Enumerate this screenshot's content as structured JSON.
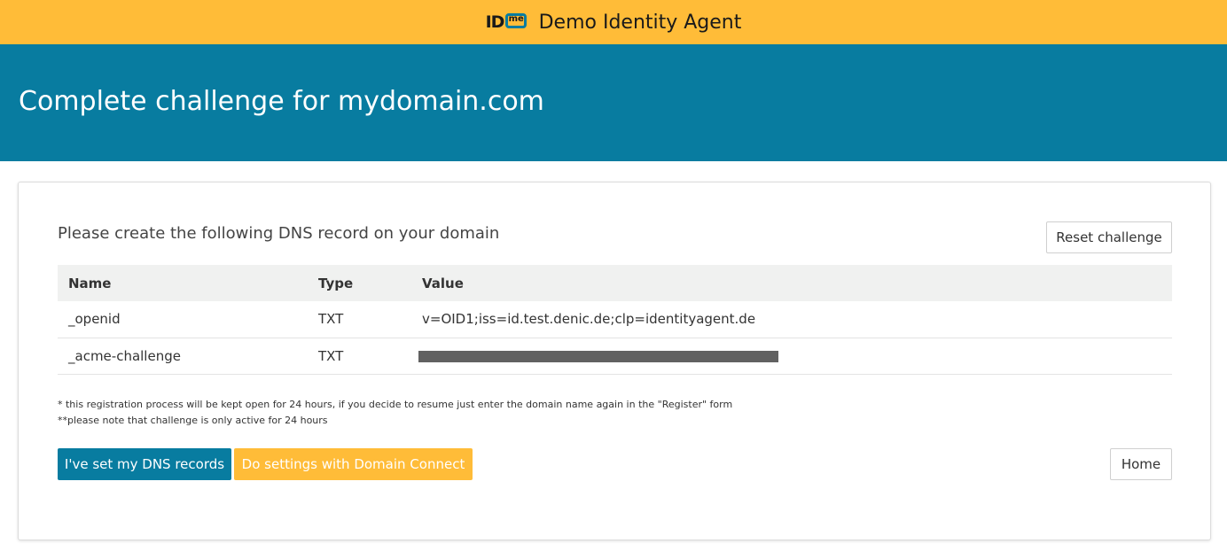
{
  "header": {
    "logo": {
      "id_text": "ID",
      "me_text": "me"
    },
    "app_title": "Demo Identity Agent",
    "colors": {
      "bar": "#ffbc38",
      "hero": "#087ca0"
    }
  },
  "hero": {
    "title": "Complete challenge for mydomain.com"
  },
  "card": {
    "instruction": "Please create the following DNS record on your domain",
    "reset_label": "Reset challenge",
    "table": {
      "headers": [
        "Name",
        "Type",
        "Value"
      ],
      "rows": [
        {
          "name": "_openid",
          "type": "TXT",
          "value": "v=OID1;iss=id.test.denic.de;clp=identityagent.de"
        },
        {
          "name": "_acme-challenge",
          "type": "TXT",
          "value": ""
        }
      ]
    },
    "notes": [
      "* this registration process will be kept open for 24 hours, if you decide to resume just enter the domain name again in the \"Register\" form",
      "**please note that challenge is only active for 24 hours"
    ],
    "buttons": {
      "dns_set": "I've set my DNS records",
      "domain_connect": "Do settings with Domain Connect",
      "home": "Home"
    }
  }
}
